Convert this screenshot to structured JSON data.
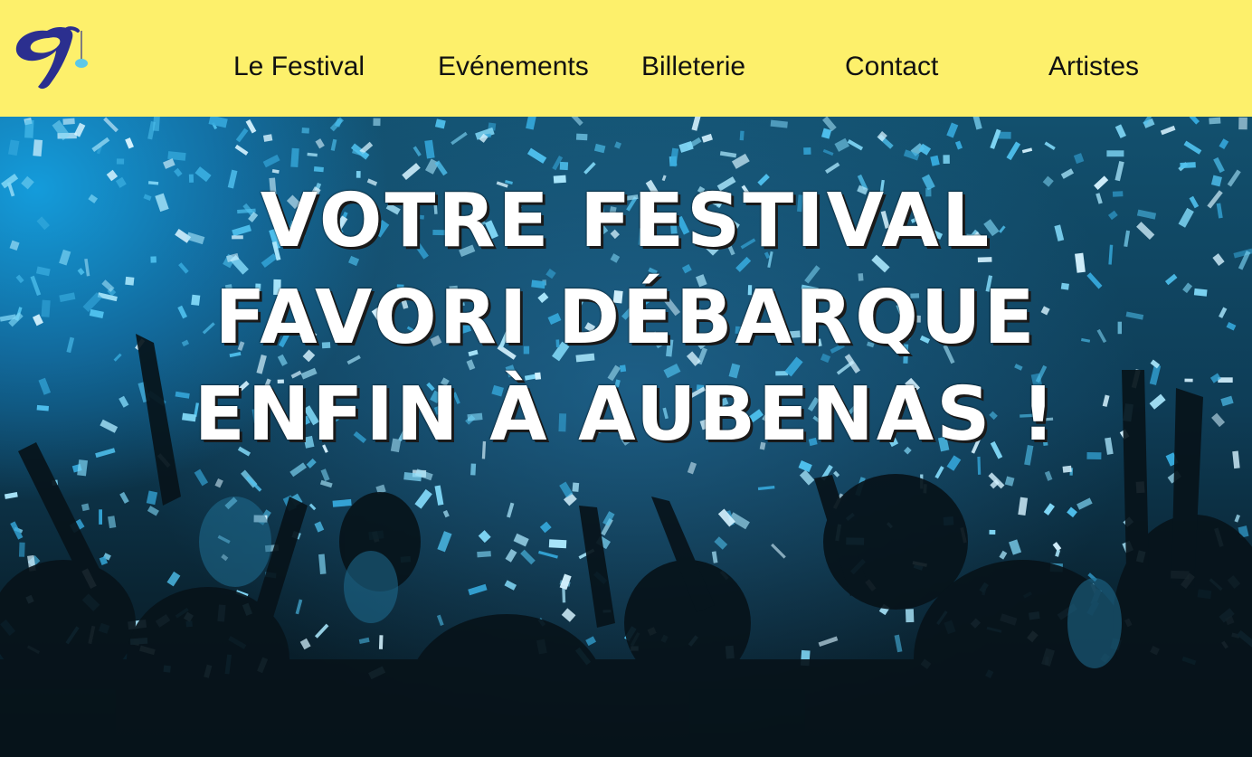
{
  "header": {
    "logo_icon": "festival-logo-9-icon",
    "background_color": "#fdf06b",
    "nav": [
      {
        "id": "festival",
        "label": "Le Festival"
      },
      {
        "id": "events",
        "label": "Evénements"
      },
      {
        "id": "ticket",
        "label": "Billeterie"
      },
      {
        "id": "contact",
        "label": "Contact"
      },
      {
        "id": "artists",
        "label": "Artistes"
      }
    ]
  },
  "hero": {
    "image_description_icon": "concert-crowd-confetti-photo",
    "accent_color": "#1aa7e0",
    "headline": {
      "line1": "VOTRE FESTIVAL",
      "line2": "FAVORI DÉBARQUE",
      "line3": "ENFIN À AUBENAS !"
    }
  }
}
